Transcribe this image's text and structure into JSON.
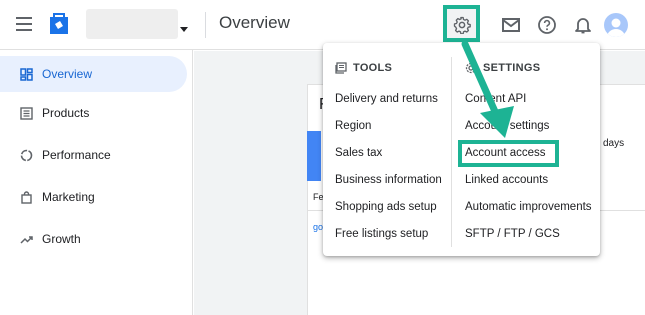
{
  "header": {
    "page_title": "Overview"
  },
  "sidebar": {
    "items": [
      {
        "label": "Overview",
        "icon": "dashboard-icon",
        "active": true
      },
      {
        "label": "Products",
        "icon": "list-icon"
      },
      {
        "label": "Performance",
        "icon": "donut-icon"
      },
      {
        "label": "Marketing",
        "icon": "bag-icon"
      },
      {
        "label": "Growth",
        "icon": "trend-icon"
      }
    ]
  },
  "card": {
    "title_partial": "F",
    "fe_text": "Fe",
    "go_text": "go",
    "days_text": "days"
  },
  "menu": {
    "tools": {
      "heading": "TOOLS",
      "items": [
        "Delivery and returns",
        "Region",
        "Sales tax",
        "Business information",
        "Shopping ads setup",
        "Free listings setup"
      ]
    },
    "settings": {
      "heading": "SETTINGS",
      "items": [
        "Content API",
        "Account settings",
        "Account access",
        "Linked accounts",
        "Automatic improvements",
        "SFTP / FTP / GCS"
      ]
    }
  },
  "colors": {
    "highlight": "#1db394",
    "active_nav_bg": "#e8f0fe",
    "active_nav_text": "#1967d2"
  }
}
